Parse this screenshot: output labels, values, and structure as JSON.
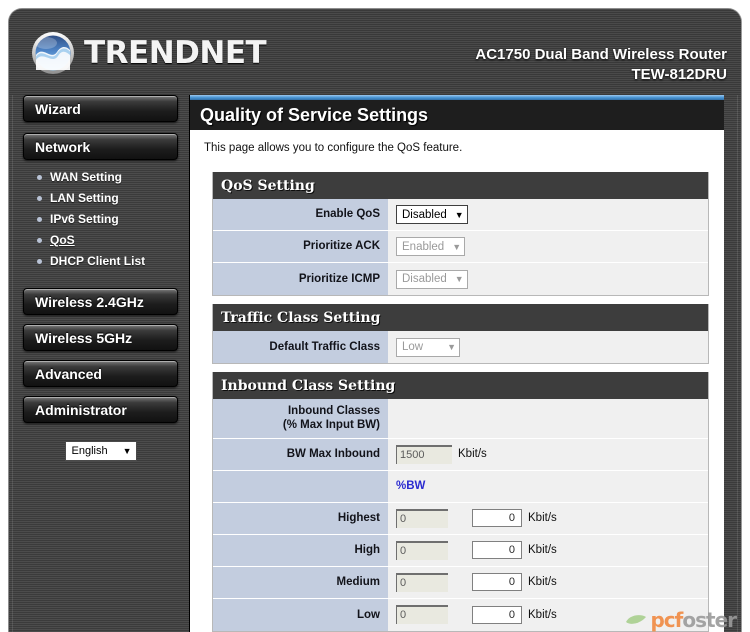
{
  "header": {
    "brand": "TRENDNET",
    "logo_icon": "trendnet-swirl-logo",
    "product_line1": "AC1750 Dual Band Wireless Router",
    "product_line2": "TEW-812DRU"
  },
  "sidebar": {
    "buttons": [
      {
        "label": "Wizard",
        "name": "wizard"
      },
      {
        "label": "Network",
        "name": "network"
      },
      {
        "label": "Wireless 2.4GHz",
        "name": "wireless-24"
      },
      {
        "label": "Wireless 5GHz",
        "name": "wireless-5"
      },
      {
        "label": "Advanced",
        "name": "advanced"
      },
      {
        "label": "Administrator",
        "name": "administrator"
      }
    ],
    "network_submenu": [
      {
        "label": "WAN Setting",
        "active": false
      },
      {
        "label": "LAN Setting",
        "active": false
      },
      {
        "label": "IPv6 Setting",
        "active": false
      },
      {
        "label": "QoS",
        "active": true
      },
      {
        "label": "DHCP Client List",
        "active": false
      }
    ],
    "language": {
      "value": "English",
      "arrow": "▼"
    }
  },
  "page": {
    "title": "Quality of Service Settings",
    "description": "This page allows you to configure the QoS feature."
  },
  "sections": {
    "qos": {
      "title": "QoS Setting",
      "rows": [
        {
          "label": "Enable QoS",
          "value": "Disabled",
          "dim": false
        },
        {
          "label": "Prioritize ACK",
          "value": "Enabled",
          "dim": true
        },
        {
          "label": "Prioritize ICMP",
          "value": "Disabled",
          "dim": true
        }
      ]
    },
    "traffic_class": {
      "title": "Traffic Class Setting",
      "rows": [
        {
          "label": "Default Traffic Class",
          "value": "Low",
          "dim": true
        }
      ]
    },
    "inbound": {
      "title": "Inbound Class Setting",
      "header_label_line1": "Inbound Classes",
      "header_label_line2": "(% Max Input BW)",
      "bw_max_label": "BW Max Inbound",
      "bw_max_value": "1500",
      "bw_max_unit": "Kbit/s",
      "percent_bw_label": "%BW",
      "classes": [
        {
          "label": "Highest",
          "percent": "0",
          "kbits": "0",
          "unit": "Kbit/s"
        },
        {
          "label": "High",
          "percent": "0",
          "kbits": "0",
          "unit": "Kbit/s"
        },
        {
          "label": "Medium",
          "percent": "0",
          "kbits": "0",
          "unit": "Kbit/s"
        },
        {
          "label": "Low",
          "percent": "0",
          "kbits": "0",
          "unit": "Kbit/s"
        }
      ]
    }
  },
  "watermark": {
    "part1": "pcf",
    "part2": "oster",
    "leaf_icon": "leaf-icon"
  },
  "colors": {
    "accent_blue": "#2b2bd0",
    "label_cell": "#c3cddf",
    "section_head": "#3d3d3d",
    "title_bar": "#1e1e1e"
  },
  "icons": {
    "dropdown_arrow": "▼"
  }
}
